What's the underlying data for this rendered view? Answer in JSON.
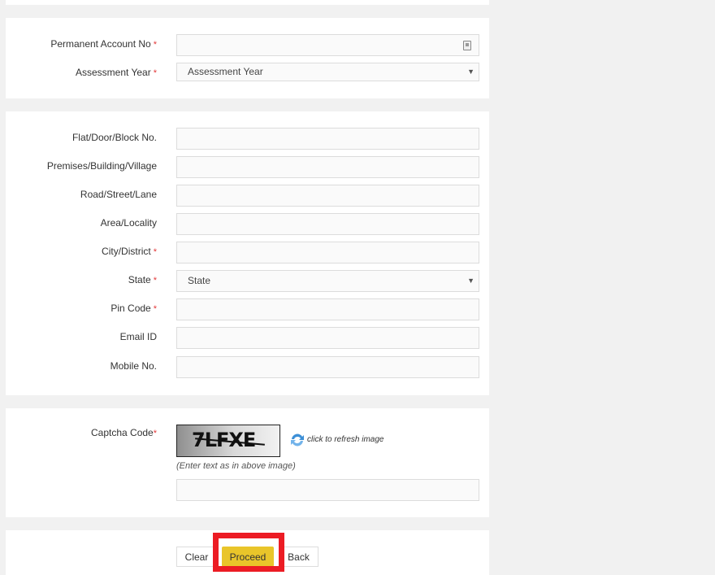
{
  "section_pan": {
    "pan_label": "Permanent Account No",
    "pan_value": "",
    "pan_icon": "id-card-icon",
    "assessment_year_label": "Assessment Year",
    "assessment_year_selected": "Assessment Year"
  },
  "section_address": {
    "flat_label": "Flat/Door/Block No.",
    "premises_label": "Premises/Building/Village",
    "road_label": "Road/Street/Lane",
    "area_label": "Area/Locality",
    "city_label": "City/District",
    "state_label": "State",
    "state_selected": "State",
    "pin_label": "Pin Code",
    "email_label": "Email ID",
    "mobile_label": "Mobile No."
  },
  "section_captcha": {
    "label": "Captcha Code",
    "captcha_image_text": "7LFXE",
    "refresh_text": "click to refresh image",
    "hint": "(Enter text as in above image)",
    "input_value": ""
  },
  "actions": {
    "clear_label": "Clear",
    "proceed_label": "Proceed",
    "back_label": "Back"
  },
  "required_marker": "*",
  "colors": {
    "page_bg": "#f1f1f1",
    "panel_bg": "#ffffff",
    "required": "#e3393a",
    "proceed_bg": "#e9c52a",
    "highlight": "#ec1c24"
  }
}
